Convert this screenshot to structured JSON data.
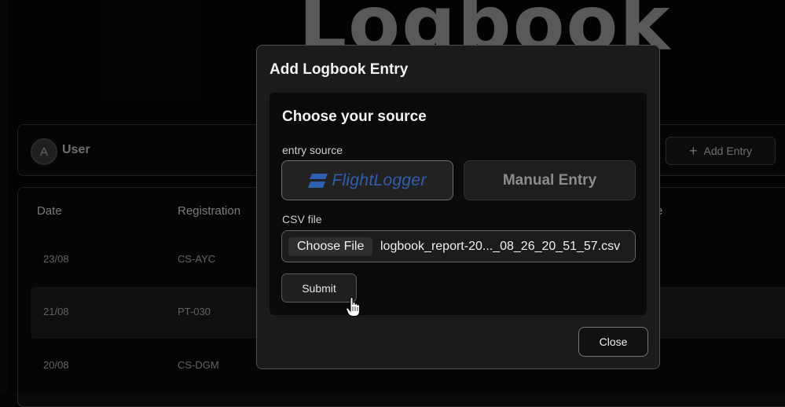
{
  "page": {
    "title": "Logbook"
  },
  "user_bar": {
    "avatar_initial": "A",
    "user_name": "User",
    "add_entry_label": "Add Entry",
    "add_icon": "plus-icon"
  },
  "table": {
    "headers": [
      "Date",
      "Registration",
      "e"
    ],
    "rows": [
      {
        "date": "23/08",
        "registration": "CS-AYC"
      },
      {
        "date": "21/08",
        "registration": "PT-030"
      },
      {
        "date": "20/08",
        "registration": "CS-DGM"
      }
    ]
  },
  "dialog": {
    "title": "Add Logbook Entry",
    "panel_title": "Choose your source",
    "source_label": "entry source",
    "source_options": {
      "flightlogger": "FlightLogger",
      "manual": "Manual Entry"
    },
    "csv_label": "CSV file",
    "choose_file_label": "Choose File",
    "file_name": "logbook_report-20..._08_26_20_51_57.csv",
    "submit_label": "Submit",
    "close_label": "Close"
  },
  "colors": {
    "background": "#050505",
    "dialog": "#1b1b1b",
    "flightlogger_blue": "#2f5fb0"
  }
}
